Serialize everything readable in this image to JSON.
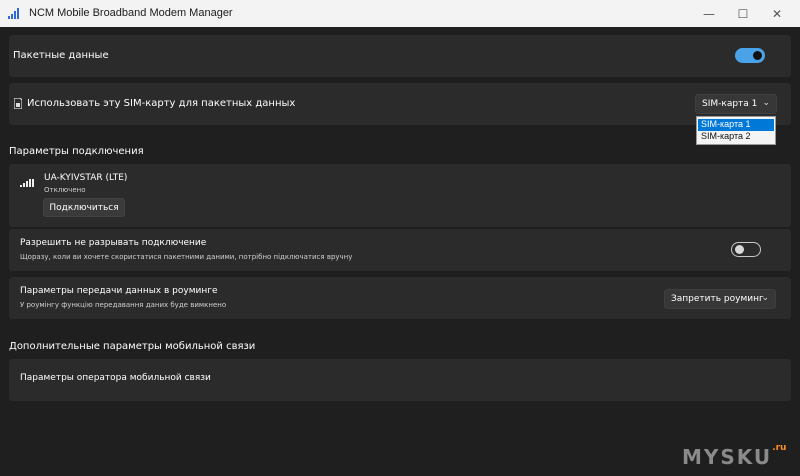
{
  "window": {
    "title": "NCM Mobile Broadband Modem Manager",
    "minimize_glyph": "—",
    "maximize_glyph": "☐",
    "close_glyph": "✕"
  },
  "packet_data": {
    "label": "Пакетные данные",
    "toggle_state": "on"
  },
  "sim_usage": {
    "label": "Использовать эту SIM-карту для пакетных данных",
    "selected": "SIM-карта 1",
    "options": [
      "SIM-карта 1",
      "SIM-карта 2"
    ],
    "highlighted_index": 0
  },
  "connection_section": {
    "title": "Параметры подключения",
    "network_name": "UA-KYIVSTAR (LTE)",
    "status": "Отключено",
    "connect_button": "Подключиться"
  },
  "keep_connection": {
    "label": "Разрешить не разрывать подключение",
    "description": "Щоразу, коли ви хочете скористатися пакетними даними, потрібно підключатися вручну",
    "toggle_state": "off"
  },
  "roaming": {
    "label": "Параметры передачи данных в роуминге",
    "description": "У роумінгу функцію передавання даних буде вимкнено",
    "selected": "Запретить роуминг"
  },
  "additional_section": {
    "title": "Дополнительные параметры мобильной связи",
    "operator_settings": "Параметры оператора мобильной связи"
  },
  "watermark": {
    "brand": "MYSKU",
    "suffix": ".ru"
  },
  "colors": {
    "accent": "#4aa3e8",
    "background": "#1f1f1f",
    "panel": "#2b2b2b",
    "selection": "#0078d7",
    "watermark_suffix": "#ff8c2a"
  },
  "icons": {
    "app": "signal-bars-icon",
    "sim": "sim-card-icon",
    "signal": "signal-strength-icon",
    "chevron": "chevron-down-icon"
  }
}
